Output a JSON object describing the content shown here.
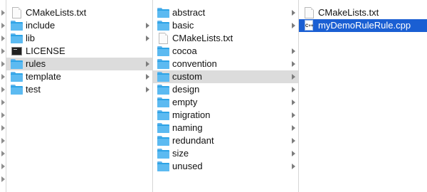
{
  "columns": [
    {
      "items": [
        {
          "label": "CMakeLists.txt",
          "icon": "text-file-icon",
          "folder": false
        },
        {
          "label": "include",
          "icon": "folder-icon",
          "folder": true
        },
        {
          "label": "lib",
          "icon": "folder-icon",
          "folder": true
        },
        {
          "label": "LICENSE",
          "icon": "terminal-file-icon",
          "folder": false
        },
        {
          "label": "rules",
          "icon": "folder-icon",
          "folder": true,
          "selected": "gray"
        },
        {
          "label": "template",
          "icon": "folder-icon",
          "folder": true
        },
        {
          "label": "test",
          "icon": "folder-icon",
          "folder": true
        }
      ]
    },
    {
      "items": [
        {
          "label": "abstract",
          "icon": "folder-icon",
          "folder": true
        },
        {
          "label": "basic",
          "icon": "folder-icon",
          "folder": true
        },
        {
          "label": "CMakeLists.txt",
          "icon": "text-file-icon",
          "folder": false
        },
        {
          "label": "cocoa",
          "icon": "folder-icon",
          "folder": true
        },
        {
          "label": "convention",
          "icon": "folder-icon",
          "folder": true
        },
        {
          "label": "custom",
          "icon": "folder-icon",
          "folder": true,
          "selected": "gray"
        },
        {
          "label": "design",
          "icon": "folder-icon",
          "folder": true
        },
        {
          "label": "empty",
          "icon": "folder-icon",
          "folder": true
        },
        {
          "label": "migration",
          "icon": "folder-icon",
          "folder": true
        },
        {
          "label": "naming",
          "icon": "folder-icon",
          "folder": true
        },
        {
          "label": "redundant",
          "icon": "folder-icon",
          "folder": true
        },
        {
          "label": "size",
          "icon": "folder-icon",
          "folder": true
        },
        {
          "label": "unused",
          "icon": "folder-icon",
          "folder": true
        }
      ]
    },
    {
      "items": [
        {
          "label": "CMakeLists.txt",
          "icon": "text-file-icon",
          "folder": false
        },
        {
          "label": "myDemoRuleRule.cpp",
          "icon": "cpp-file-icon",
          "folder": false,
          "selected": "blue"
        }
      ]
    }
  ],
  "cpp_icon_tag": "C++",
  "colors": {
    "selection_blue": "#1a5fd3",
    "selection_gray": "#dcdcdc",
    "folder": "#5cbaf1"
  }
}
